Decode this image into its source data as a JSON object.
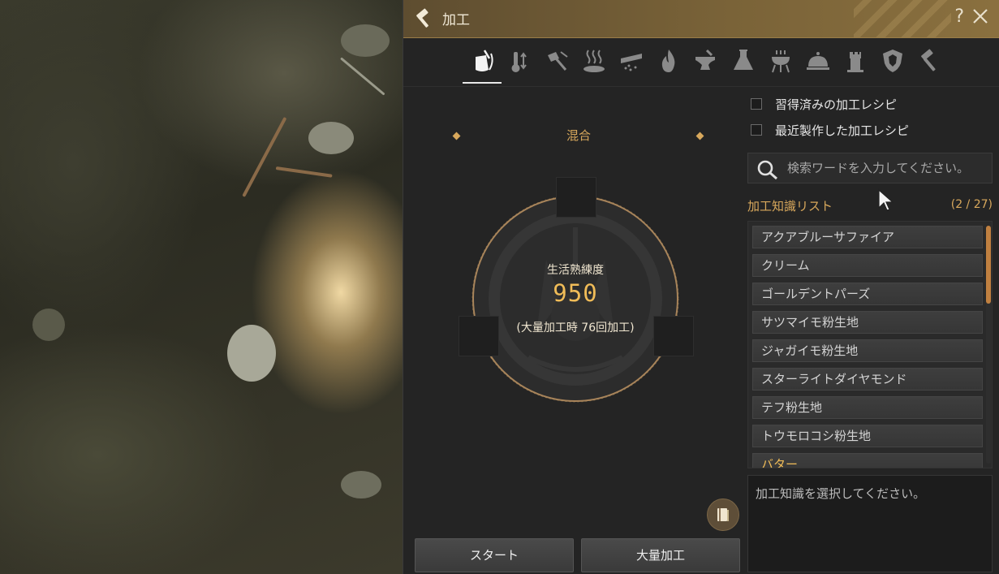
{
  "window": {
    "title": "加工",
    "help_label": "?"
  },
  "tabs": [
    {
      "name": "mixing-icon",
      "active": true
    },
    {
      "name": "heating-icon",
      "active": false
    },
    {
      "name": "chopping-icon",
      "active": false
    },
    {
      "name": "drying-icon",
      "active": false
    },
    {
      "name": "filtering-icon",
      "active": false
    },
    {
      "name": "fire-icon",
      "active": false
    },
    {
      "name": "anvil-icon",
      "active": false
    },
    {
      "name": "alchemy-flask-icon",
      "active": false
    },
    {
      "name": "grill-icon",
      "active": false
    },
    {
      "name": "cloche-icon",
      "active": false
    },
    {
      "name": "tower-icon",
      "active": false
    },
    {
      "name": "shield-icon",
      "active": false
    },
    {
      "name": "hammer-icon",
      "active": false
    }
  ],
  "process": {
    "label": "混合",
    "skill_title": "生活熟練度",
    "skill_value": "950",
    "mass_text": "(大量加工時 76回加工)"
  },
  "buttons": {
    "start": "スタート",
    "mass": "大量加工"
  },
  "filters": {
    "learned": "習得済みの加工レシピ",
    "recent": "最近製作した加工レシピ"
  },
  "search": {
    "placeholder": "検索ワードを入力してください。"
  },
  "list": {
    "title": "加工知識リスト",
    "count": "(2 / 27)",
    "items": [
      {
        "label": "アクアブルーサファイア",
        "highlight": false
      },
      {
        "label": "クリーム",
        "highlight": false
      },
      {
        "label": "ゴールデントパーズ",
        "highlight": false
      },
      {
        "label": "サツマイモ粉生地",
        "highlight": false
      },
      {
        "label": "ジャガイモ粉生地",
        "highlight": false
      },
      {
        "label": "スターライトダイヤモンド",
        "highlight": false
      },
      {
        "label": "テフ粉生地",
        "highlight": false
      },
      {
        "label": "トウモロコシ粉生地",
        "highlight": false
      },
      {
        "label": "バター",
        "highlight": true
      }
    ]
  },
  "description": "加工知識を選択してください。",
  "colors": {
    "accent": "#d8a85c",
    "value": "#f0bc58",
    "titlebar": "#7a6338"
  }
}
